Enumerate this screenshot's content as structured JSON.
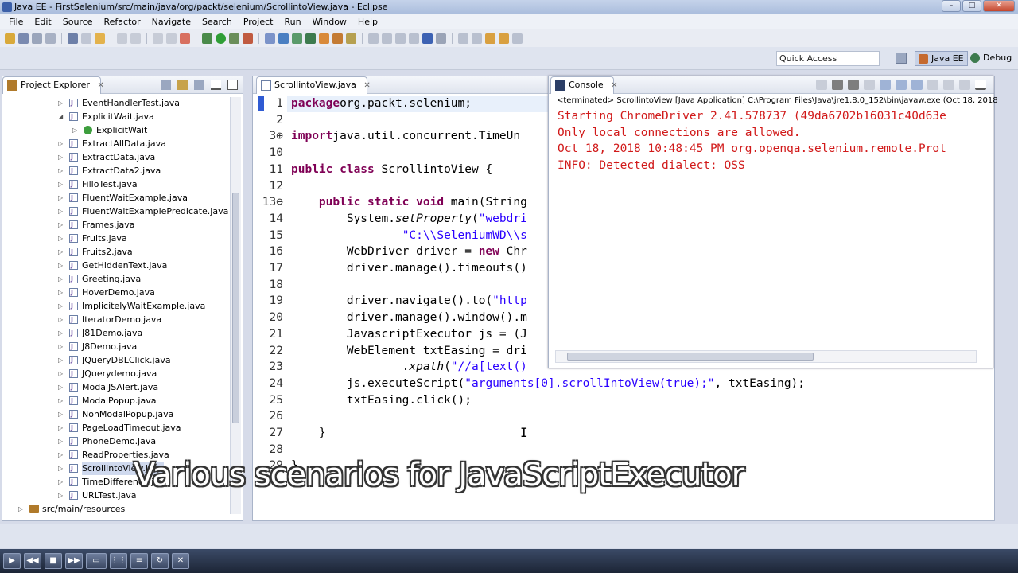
{
  "window": {
    "title": "Java EE - FirstSelenium/src/main/java/org/packt/selenium/ScrollintoView.java - Eclipse",
    "controls": [
      "–",
      "□",
      "✕"
    ]
  },
  "menu": [
    "File",
    "Edit",
    "Source",
    "Refactor",
    "Navigate",
    "Search",
    "Project",
    "Run",
    "Window",
    "Help"
  ],
  "quick_access": {
    "placeholder": "Quick Access"
  },
  "perspectives": {
    "java_ee": "Java EE",
    "debug": "Debug"
  },
  "project_explorer": {
    "tab_label": "Project Explorer",
    "items": [
      {
        "label": "EventHandlerTest.java",
        "type": "file",
        "expanded": false
      },
      {
        "label": "ExplicitWait.java",
        "type": "file",
        "expanded": true
      },
      {
        "label": "ExplicitWait",
        "type": "class"
      },
      {
        "label": "ExtractAllData.java",
        "type": "file"
      },
      {
        "label": "ExtractData.java",
        "type": "file"
      },
      {
        "label": "ExtractData2.java",
        "type": "file"
      },
      {
        "label": "FilloTest.java",
        "type": "file"
      },
      {
        "label": "FluentWaitExample.java",
        "type": "file"
      },
      {
        "label": "FluentWaitExamplePredicate.java",
        "type": "file"
      },
      {
        "label": "Frames.java",
        "type": "file"
      },
      {
        "label": "Fruits.java",
        "type": "file"
      },
      {
        "label": "Fruits2.java",
        "type": "file"
      },
      {
        "label": "GetHiddenText.java",
        "type": "file"
      },
      {
        "label": "Greeting.java",
        "type": "file"
      },
      {
        "label": "HoverDemo.java",
        "type": "file"
      },
      {
        "label": "ImplicitelyWaitExample.java",
        "type": "file"
      },
      {
        "label": "IteratorDemo.java",
        "type": "file"
      },
      {
        "label": "J81Demo.java",
        "type": "file"
      },
      {
        "label": "J8Demo.java",
        "type": "file"
      },
      {
        "label": "JQueryDBLClick.java",
        "type": "file"
      },
      {
        "label": "JQuerydemo.java",
        "type": "file"
      },
      {
        "label": "ModalJSAlert.java",
        "type": "file"
      },
      {
        "label": "ModalPopup.java",
        "type": "file"
      },
      {
        "label": "NonModalPopup.java",
        "type": "file"
      },
      {
        "label": "PageLoadTimeout.java",
        "type": "file"
      },
      {
        "label": "PhoneDemo.java",
        "type": "file"
      },
      {
        "label": "ReadProperties.java",
        "type": "file"
      },
      {
        "label": "ScrollintoView.java",
        "type": "file",
        "selected": true
      },
      {
        "label": "TimeDifference.java",
        "type": "file"
      },
      {
        "label": "URLTest.java",
        "type": "file"
      },
      {
        "label": "src/main/resources",
        "type": "folder"
      }
    ]
  },
  "editor": {
    "tab_label": "ScrollintoView.java",
    "lines": [
      {
        "num": "1",
        "parts": [
          [
            "kw",
            "package"
          ],
          [
            "",
            "org.packt.selenium;"
          ]
        ]
      },
      {
        "num": "2",
        "parts": []
      },
      {
        "num": "3⊕",
        "parts": [
          [
            "kw",
            "import"
          ],
          [
            "",
            "java.util.concurrent.TimeUn"
          ]
        ]
      },
      {
        "num": "10",
        "parts": []
      },
      {
        "num": "11",
        "parts": [
          [
            "kw",
            "public class"
          ],
          [
            "",
            " ScrollintoView {"
          ]
        ]
      },
      {
        "num": "12",
        "parts": []
      },
      {
        "num": "13⊖",
        "parts": [
          [
            "",
            "    "
          ],
          [
            "kw",
            "public static void"
          ],
          [
            "",
            " main(String"
          ]
        ]
      },
      {
        "num": "14",
        "parts": [
          [
            "",
            "        System."
          ],
          [
            "it",
            "setProperty"
          ],
          [
            "",
            "("
          ],
          [
            "str",
            "\"webdri"
          ]
        ]
      },
      {
        "num": "15",
        "parts": [
          [
            "",
            "                "
          ],
          [
            "str",
            "\"C:\\\\SeleniumWD\\\\s"
          ]
        ]
      },
      {
        "num": "16",
        "parts": [
          [
            "",
            "        WebDriver driver = "
          ],
          [
            "kw",
            "new"
          ],
          [
            "",
            " Chr"
          ]
        ]
      },
      {
        "num": "17",
        "parts": [
          [
            "",
            "        driver.manage().timeouts()"
          ]
        ]
      },
      {
        "num": "18",
        "parts": []
      },
      {
        "num": "19",
        "parts": [
          [
            "",
            "        driver.navigate().to("
          ],
          [
            "str",
            "\"http"
          ]
        ]
      },
      {
        "num": "20",
        "parts": [
          [
            "",
            "        driver.manage().window().m"
          ]
        ]
      },
      {
        "num": "21",
        "parts": [
          [
            "",
            "        JavascriptExecutor js = (J"
          ]
        ]
      },
      {
        "num": "22",
        "parts": [
          [
            "",
            "        WebElement txtEasing = dri"
          ]
        ]
      },
      {
        "num": "23",
        "parts": [
          [
            "",
            "                ."
          ],
          [
            "it",
            "xpath"
          ],
          [
            "",
            "("
          ],
          [
            "str",
            "\"//a[text()"
          ]
        ]
      },
      {
        "num": "24",
        "parts": [
          [
            "",
            "        js.executeScript("
          ],
          [
            "str",
            "\"arguments[0].scrollIntoView(true);\""
          ],
          [
            "",
            ", txtEasing);"
          ]
        ]
      },
      {
        "num": "25",
        "parts": [
          [
            "",
            "        txtEasing.click();"
          ]
        ]
      },
      {
        "num": "26",
        "parts": []
      },
      {
        "num": "27",
        "parts": [
          [
            "",
            "    }"
          ]
        ]
      },
      {
        "num": "28",
        "parts": []
      },
      {
        "num": "29",
        "parts": [
          [
            "",
            "}"
          ]
        ]
      }
    ]
  },
  "console": {
    "tab_label": "Console",
    "terminated": "<terminated> ScrollintoView [Java Application] C:\\Program Files\\Java\\jre1.8.0_152\\bin\\javaw.exe (Oct 18, 2018",
    "lines": [
      "Starting ChromeDriver 2.41.578737 (49da6702b16031c40d63e",
      "Only local connections are allowed.",
      "Oct 18, 2018 10:48:45 PM org.openqa.selenium.remote.Prot",
      "INFO: Detected dialect: OSS"
    ]
  },
  "caption": "Various scenarios for JavaScriptExecutor",
  "colors": {
    "keyword": "#7f0055",
    "string": "#2a00ff",
    "console_err": "#d11a1a"
  }
}
